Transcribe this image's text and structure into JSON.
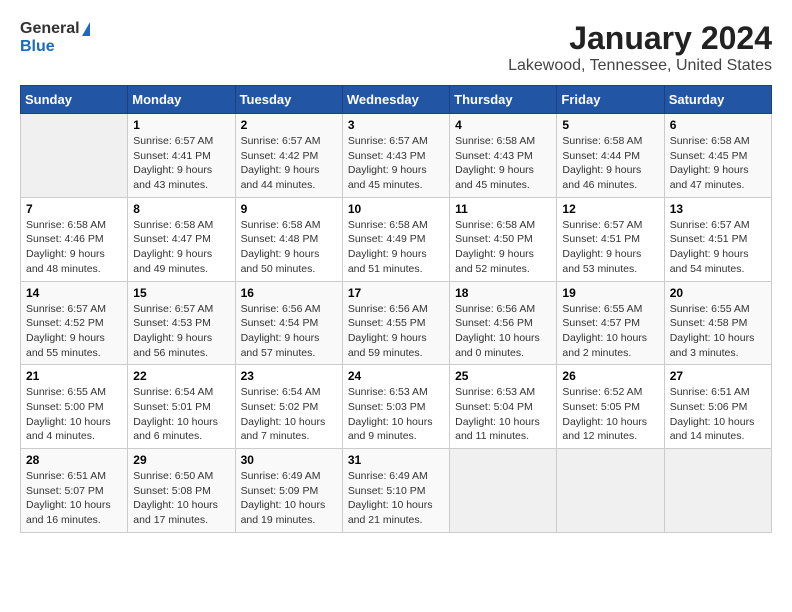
{
  "logo": {
    "general": "General",
    "blue": "Blue"
  },
  "header": {
    "title": "January 2024",
    "subtitle": "Lakewood, Tennessee, United States"
  },
  "days_of_week": [
    "Sunday",
    "Monday",
    "Tuesday",
    "Wednesday",
    "Thursday",
    "Friday",
    "Saturday"
  ],
  "weeks": [
    [
      {
        "day": "",
        "info": ""
      },
      {
        "day": "1",
        "info": "Sunrise: 6:57 AM\nSunset: 4:41 PM\nDaylight: 9 hours\nand 43 minutes."
      },
      {
        "day": "2",
        "info": "Sunrise: 6:57 AM\nSunset: 4:42 PM\nDaylight: 9 hours\nand 44 minutes."
      },
      {
        "day": "3",
        "info": "Sunrise: 6:57 AM\nSunset: 4:43 PM\nDaylight: 9 hours\nand 45 minutes."
      },
      {
        "day": "4",
        "info": "Sunrise: 6:58 AM\nSunset: 4:43 PM\nDaylight: 9 hours\nand 45 minutes."
      },
      {
        "day": "5",
        "info": "Sunrise: 6:58 AM\nSunset: 4:44 PM\nDaylight: 9 hours\nand 46 minutes."
      },
      {
        "day": "6",
        "info": "Sunrise: 6:58 AM\nSunset: 4:45 PM\nDaylight: 9 hours\nand 47 minutes."
      }
    ],
    [
      {
        "day": "7",
        "info": "Sunrise: 6:58 AM\nSunset: 4:46 PM\nDaylight: 9 hours\nand 48 minutes."
      },
      {
        "day": "8",
        "info": "Sunrise: 6:58 AM\nSunset: 4:47 PM\nDaylight: 9 hours\nand 49 minutes."
      },
      {
        "day": "9",
        "info": "Sunrise: 6:58 AM\nSunset: 4:48 PM\nDaylight: 9 hours\nand 50 minutes."
      },
      {
        "day": "10",
        "info": "Sunrise: 6:58 AM\nSunset: 4:49 PM\nDaylight: 9 hours\nand 51 minutes."
      },
      {
        "day": "11",
        "info": "Sunrise: 6:58 AM\nSunset: 4:50 PM\nDaylight: 9 hours\nand 52 minutes."
      },
      {
        "day": "12",
        "info": "Sunrise: 6:57 AM\nSunset: 4:51 PM\nDaylight: 9 hours\nand 53 minutes."
      },
      {
        "day": "13",
        "info": "Sunrise: 6:57 AM\nSunset: 4:51 PM\nDaylight: 9 hours\nand 54 minutes."
      }
    ],
    [
      {
        "day": "14",
        "info": "Sunrise: 6:57 AM\nSunset: 4:52 PM\nDaylight: 9 hours\nand 55 minutes."
      },
      {
        "day": "15",
        "info": "Sunrise: 6:57 AM\nSunset: 4:53 PM\nDaylight: 9 hours\nand 56 minutes."
      },
      {
        "day": "16",
        "info": "Sunrise: 6:56 AM\nSunset: 4:54 PM\nDaylight: 9 hours\nand 57 minutes."
      },
      {
        "day": "17",
        "info": "Sunrise: 6:56 AM\nSunset: 4:55 PM\nDaylight: 9 hours\nand 59 minutes."
      },
      {
        "day": "18",
        "info": "Sunrise: 6:56 AM\nSunset: 4:56 PM\nDaylight: 10 hours\nand 0 minutes."
      },
      {
        "day": "19",
        "info": "Sunrise: 6:55 AM\nSunset: 4:57 PM\nDaylight: 10 hours\nand 2 minutes."
      },
      {
        "day": "20",
        "info": "Sunrise: 6:55 AM\nSunset: 4:58 PM\nDaylight: 10 hours\nand 3 minutes."
      }
    ],
    [
      {
        "day": "21",
        "info": "Sunrise: 6:55 AM\nSunset: 5:00 PM\nDaylight: 10 hours\nand 4 minutes."
      },
      {
        "day": "22",
        "info": "Sunrise: 6:54 AM\nSunset: 5:01 PM\nDaylight: 10 hours\nand 6 minutes."
      },
      {
        "day": "23",
        "info": "Sunrise: 6:54 AM\nSunset: 5:02 PM\nDaylight: 10 hours\nand 7 minutes."
      },
      {
        "day": "24",
        "info": "Sunrise: 6:53 AM\nSunset: 5:03 PM\nDaylight: 10 hours\nand 9 minutes."
      },
      {
        "day": "25",
        "info": "Sunrise: 6:53 AM\nSunset: 5:04 PM\nDaylight: 10 hours\nand 11 minutes."
      },
      {
        "day": "26",
        "info": "Sunrise: 6:52 AM\nSunset: 5:05 PM\nDaylight: 10 hours\nand 12 minutes."
      },
      {
        "day": "27",
        "info": "Sunrise: 6:51 AM\nSunset: 5:06 PM\nDaylight: 10 hours\nand 14 minutes."
      }
    ],
    [
      {
        "day": "28",
        "info": "Sunrise: 6:51 AM\nSunset: 5:07 PM\nDaylight: 10 hours\nand 16 minutes."
      },
      {
        "day": "29",
        "info": "Sunrise: 6:50 AM\nSunset: 5:08 PM\nDaylight: 10 hours\nand 17 minutes."
      },
      {
        "day": "30",
        "info": "Sunrise: 6:49 AM\nSunset: 5:09 PM\nDaylight: 10 hours\nand 19 minutes."
      },
      {
        "day": "31",
        "info": "Sunrise: 6:49 AM\nSunset: 5:10 PM\nDaylight: 10 hours\nand 21 minutes."
      },
      {
        "day": "",
        "info": ""
      },
      {
        "day": "",
        "info": ""
      },
      {
        "day": "",
        "info": ""
      }
    ]
  ]
}
